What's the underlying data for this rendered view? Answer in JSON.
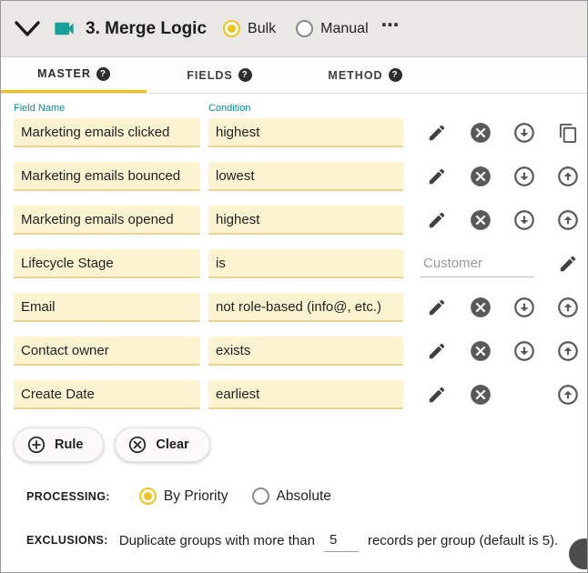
{
  "header": {
    "title": "3. Merge Logic",
    "modes": [
      {
        "label": "Bulk",
        "selected": true
      },
      {
        "label": "Manual",
        "selected": false
      }
    ],
    "overflow_menu": "⋯"
  },
  "tabs": [
    {
      "label": "MASTER",
      "help": "?",
      "active": true
    },
    {
      "label": "FIELDS",
      "help": "?",
      "active": false
    },
    {
      "label": "METHOD",
      "help": "?",
      "active": false
    }
  ],
  "columns": {
    "field": "Field Name",
    "condition": "Condition"
  },
  "rules": [
    {
      "field": "Marketing emails clicked",
      "condition": "highest",
      "icons": [
        "edit",
        "remove",
        "move-down",
        "duplicate"
      ]
    },
    {
      "field": "Marketing emails bounced",
      "condition": "lowest",
      "icons": [
        "edit",
        "remove",
        "move-down",
        "move-up"
      ]
    },
    {
      "field": "Marketing emails opened",
      "condition": "highest",
      "icons": [
        "edit",
        "remove",
        "move-down",
        "move-up"
      ]
    },
    {
      "field": "Lifecycle Stage",
      "condition": "is",
      "value": "Customer",
      "icons": [
        "edit"
      ]
    },
    {
      "field": "Email",
      "condition": "not role-based (info@, etc.)",
      "icons": [
        "edit",
        "remove",
        "move-down",
        "move-up"
      ]
    },
    {
      "field": "Contact owner",
      "condition": "exists",
      "icons": [
        "edit",
        "remove",
        "move-down",
        "move-up"
      ]
    },
    {
      "field": "Create Date",
      "condition": "earliest",
      "icons": [
        "edit",
        "remove",
        "move-up"
      ]
    }
  ],
  "buttons": {
    "rule": "Rule",
    "clear": "Clear"
  },
  "processing": {
    "label": "PROCESSING:",
    "options": [
      {
        "label": "By Priority",
        "selected": true
      },
      {
        "label": "Absolute",
        "selected": false
      }
    ]
  },
  "exclusions": {
    "label": "EXCLUSIONS:",
    "text_before": "Duplicate groups with more than",
    "value": "5",
    "text_after": "records per group (default is 5)."
  },
  "colors": {
    "accent_yellow": "#f1c21b",
    "input_yellow_bg": "#fcf4d1",
    "input_yellow_border": "#e9d692",
    "teal": "#0f8b85",
    "icon_gray": "#58595b",
    "header_bg": "#eae8e5"
  }
}
